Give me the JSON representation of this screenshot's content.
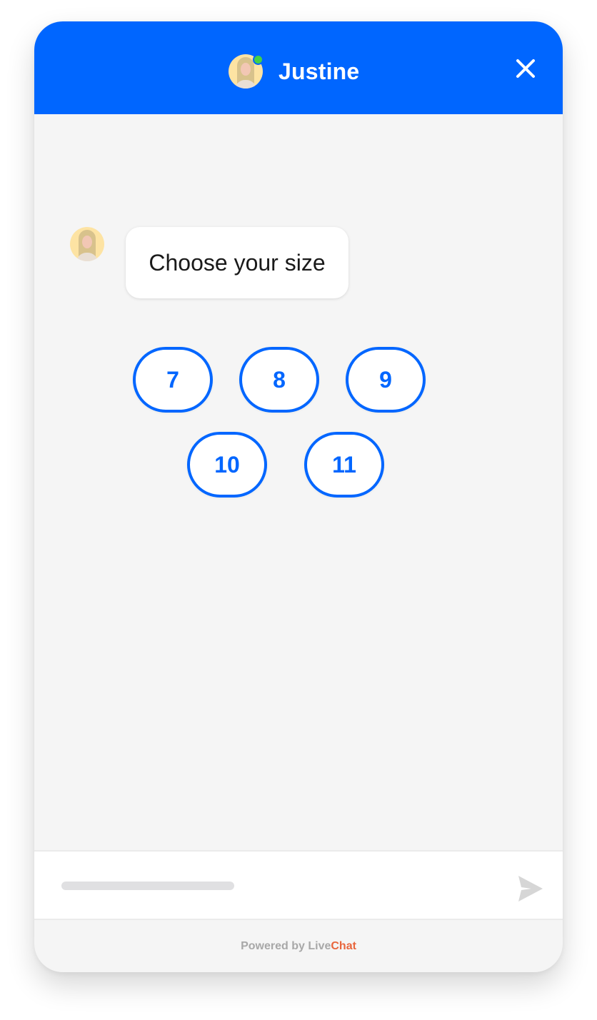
{
  "header": {
    "agent_name": "Justine",
    "agent_status": "online",
    "avatar_icon": "agent-avatar",
    "close_icon": "close-icon",
    "background_color": "#0066ff",
    "status_color": "#45d145"
  },
  "messages": [
    {
      "sender": "Justine",
      "text": "Choose your size"
    }
  ],
  "quick_replies": {
    "options": [
      "7",
      "8",
      "9",
      "10",
      "11"
    ],
    "accent_color": "#0066ff"
  },
  "composer": {
    "placeholder": "",
    "send_icon": "send-icon"
  },
  "footer": {
    "powered_by": "Powered by ",
    "brand_part1": "Live",
    "brand_part2": "Chat",
    "brand_accent_color": "#e8663d"
  }
}
